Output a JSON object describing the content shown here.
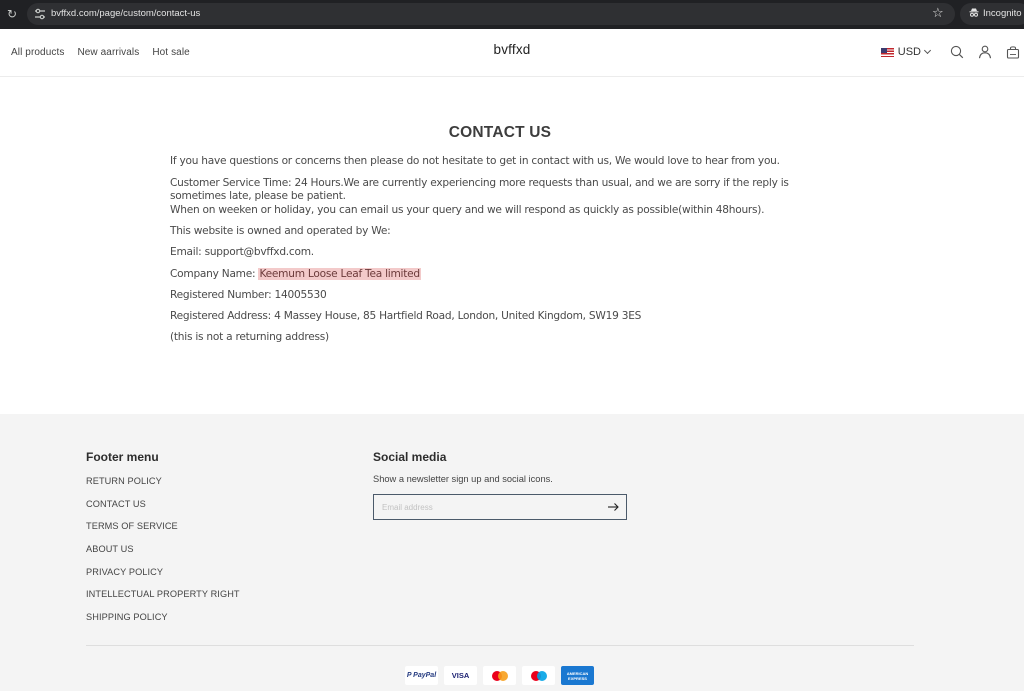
{
  "browser": {
    "url": "bvffxd.com/page/custom/contact-us",
    "incognito_label": "Incognito"
  },
  "header": {
    "nav": [
      {
        "label": "All products"
      },
      {
        "label": "New aarrivals"
      },
      {
        "label": "Hot sale"
      }
    ],
    "logo": "bvffxd",
    "currency": "USD",
    "icons": [
      "search-icon",
      "account-icon",
      "cart-icon"
    ]
  },
  "main": {
    "title": "CONTACT US",
    "intro": "If you have questions or concerns then please do not hesitate to get in contact with us, We would love to hear from you.",
    "service_line1": "Customer Service Time: 24 Hours.We are currently experiencing more requests than usual, and we are sorry if the reply is sometimes late, please be patient.",
    "service_line2": "When on weeken or holiday, you can email us your query and we will respond as quickly as possible(within 48hours).",
    "owned_by": "This website is owned and operated by We:",
    "email_line": "Email: support@bvffxd.com.",
    "company_label": "Company Name: ",
    "company_name": "Keemum Loose Leaf Tea limited",
    "registered_number": "Registered Number: 14005530",
    "registered_address": "Registered Address: 4 Massey House, 85 Hartfield Road, London, United Kingdom, SW19 3ES",
    "address_note": "(this is not a returning address)",
    "highlight_color": "#f3caca"
  },
  "footer": {
    "menu_title": "Footer menu",
    "menu_items": [
      {
        "label": "RETURN POLICY"
      },
      {
        "label": "CONTACT US"
      },
      {
        "label": "TERMS OF SERVICE"
      },
      {
        "label": "ABOUT US"
      },
      {
        "label": "PRIVACY POLICY"
      },
      {
        "label": "INTELLECTUAL PROPERTY RIGHT"
      },
      {
        "label": "SHIPPING POLICY"
      }
    ],
    "social_title": "Social media",
    "social_desc": "Show a newsletter sign up and social icons.",
    "email_placeholder": "Email address",
    "payments": [
      {
        "name": "PayPal",
        "label": "P PayPal"
      },
      {
        "name": "Visa",
        "label": "VISA"
      },
      {
        "name": "Mastercard",
        "label": ""
      },
      {
        "name": "Maestro",
        "label": ""
      },
      {
        "name": "American Express",
        "label": "AMERICAN EXPRESS"
      }
    ]
  }
}
